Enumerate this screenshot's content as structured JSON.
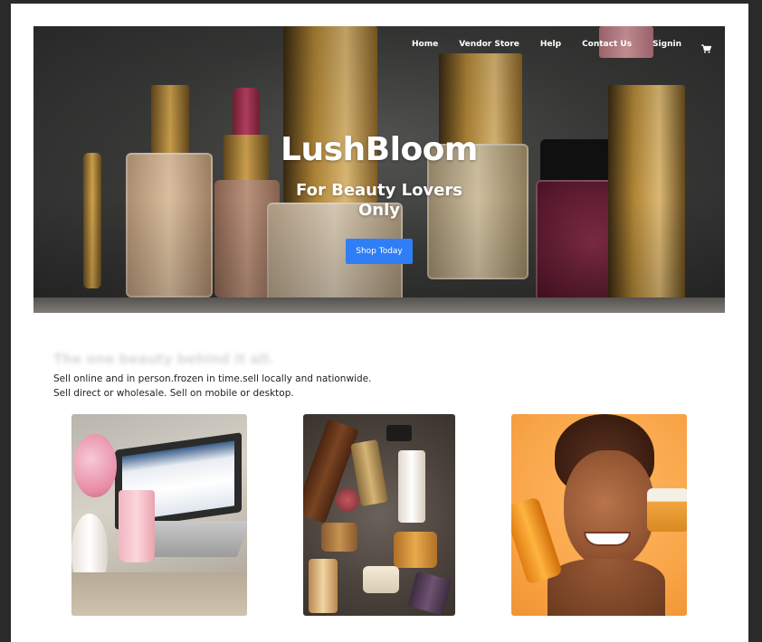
{
  "nav": {
    "links": [
      "Home",
      "Vendor Store",
      "Help",
      "Contact Us",
      "Signin"
    ],
    "cart_icon": "cart-icon"
  },
  "hero": {
    "title": "LushBloom",
    "subtitle_line1": "For Beauty Lovers",
    "subtitle_line2": "Only",
    "cta_label": "Shop Today"
  },
  "section": {
    "title": "The one beauty behind it all.",
    "description_line1": "Sell online and in person.frozen in time.sell locally and nationwide.",
    "description_line2": "Sell direct or wholesale. Sell on mobile or desktop."
  },
  "colors": {
    "accent": "#2f7ef5",
    "hero_bg": "#3e3f3d"
  }
}
